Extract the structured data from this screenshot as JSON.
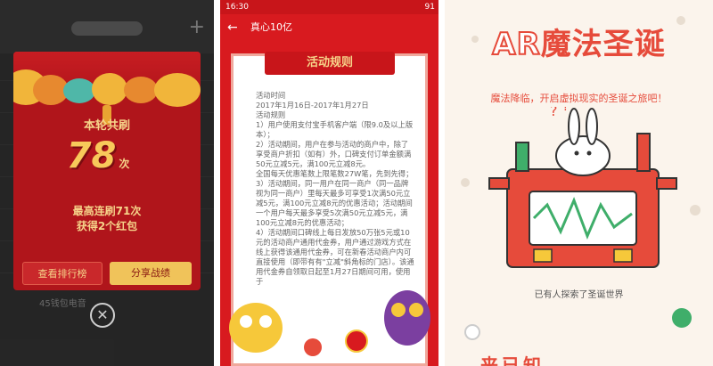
{
  "panel1": {
    "card": {
      "title": "本轮共刷",
      "count": "78",
      "count_unit": "次",
      "line1": "最高连刷71次",
      "line2": "获得2个红包",
      "btn_leaderboard": "查看排行榜",
      "btn_share": "分享战绩"
    },
    "bg_row_text": "45钱包电音",
    "close_icon": "✕"
  },
  "panel2": {
    "status_time": "16:30",
    "status_battery": "91",
    "nav_title": "真心10亿",
    "banner": "活动规则",
    "rules_text": "活动时间\n2017年1月16日-2017年1月27日\n活动规则\n1）用户使用支付宝手机客户端（限9.0及以上版本）；\n2）活动期间，用户在参与活动的商户中，除了享受商户折扣（如有）外，口碑支付订单金额满50元立减5元，满100元立减8元。\n全国每天优惠笔数上限笔数27W笔，先到先得；\n3）活动期间，同一用户在同一商户（同一品牌视为同一商户）里每天最多可享受1次满50元立减5元，满100元立减8元的优惠活动；活动期间一个用户每天最多享受5次满50元立减5元，满100元立减8元的优惠活动；\n4）活动期间口碑线上每日发放50万张5元或10元的活动商户通用代金券，用户通过游戏方式在线上获得该通用代金券，可在新春活动商户内可直接使用（即带有有\"立减\"斜角标的门店）。该通用代金券自领取日起至1月27日期间可用，使用于"
  },
  "panel3": {
    "title_ar": "AR",
    "title_rest": "魔法圣诞",
    "subtitle": "魔法降临，开启虚拟现实的圣诞之旅吧！",
    "caption": "已有人探索了圣诞世界",
    "bottom": "来已知"
  }
}
